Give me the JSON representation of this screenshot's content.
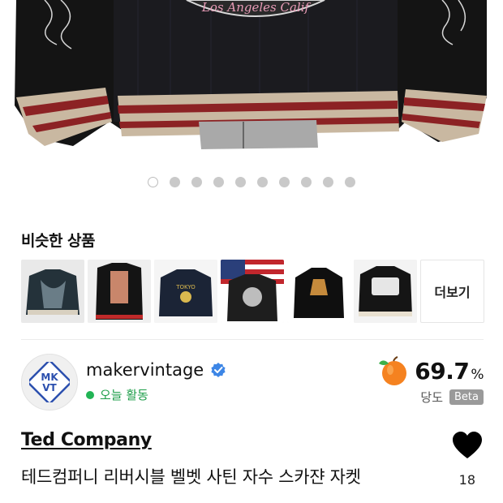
{
  "hero": {
    "patch_text": "Los Angeles Calif"
  },
  "carousel": {
    "count": 10,
    "active_index": 0
  },
  "similar": {
    "title": "비슷한 상품",
    "more_label": "더보기",
    "items": [
      {
        "name": "jacket-1",
        "icon": "jacket-thumbnail"
      },
      {
        "name": "jacket-2",
        "icon": "jacket-thumbnail"
      },
      {
        "name": "jacket-3",
        "icon": "jacket-thumbnail"
      },
      {
        "name": "jacket-4",
        "icon": "jacket-thumbnail"
      },
      {
        "name": "jacket-5",
        "icon": "jacket-thumbnail"
      },
      {
        "name": "jacket-6",
        "icon": "jacket-thumbnail"
      }
    ]
  },
  "seller": {
    "avatar_text_top": "MK",
    "avatar_text_bottom": "VT",
    "name": "makervintage",
    "status": "오늘 활동",
    "sweetness_value": "69.7",
    "sweetness_unit": "%",
    "sweetness_label": "당도",
    "beta_label": "Beta"
  },
  "product": {
    "brand": "Ted Company",
    "title": "테드컴퍼니 리버시블 벨벳 사틴 자수 스카쟌 자켓",
    "like_count": "18"
  },
  "colors": {
    "status_green": "#22b455",
    "verified_blue": "#3d86e6",
    "avatar_blue": "#2b4fae",
    "heart": "#000000"
  }
}
